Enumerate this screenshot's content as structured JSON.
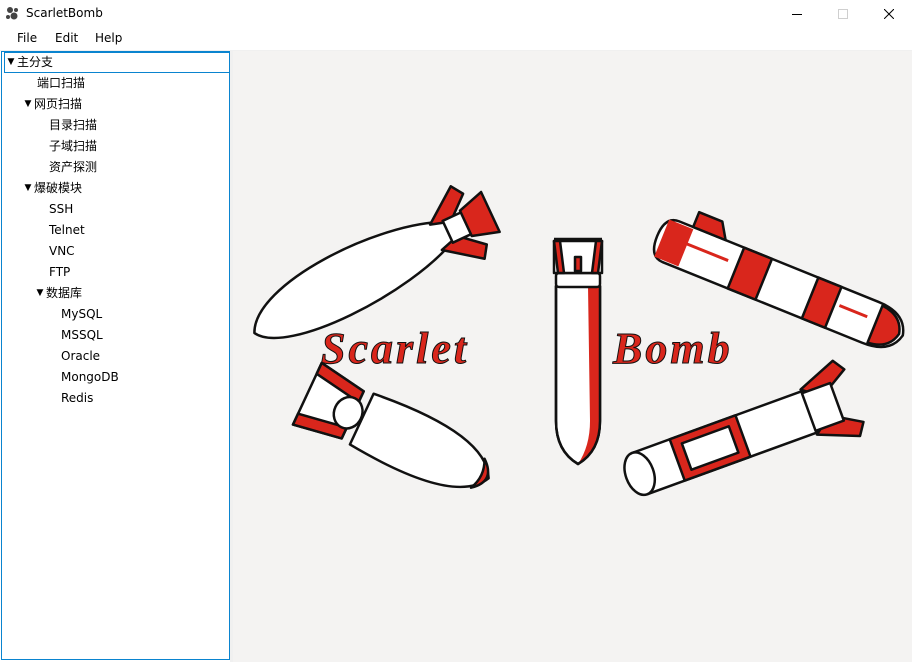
{
  "window": {
    "title": "ScarletBomb"
  },
  "menubar": {
    "items": [
      "File",
      "Edit",
      "Help"
    ]
  },
  "tree": {
    "root": "主分支",
    "items": [
      {
        "label": "端口扫描"
      },
      {
        "label": "网页扫描",
        "children": [
          "目录扫描",
          "子域扫描",
          "资产探测"
        ]
      },
      {
        "label": "爆破模块",
        "children": [
          "SSH",
          "Telnet",
          "VNC",
          "FTP"
        ]
      },
      {
        "label": "数据库",
        "children": [
          "MySQL",
          "MSSQL",
          "Oracle",
          "MongoDB",
          "Redis"
        ]
      }
    ]
  },
  "logo": {
    "text_part1": "Scarlet",
    "text_part2": "Bomb",
    "accent_color": "#d9261c"
  }
}
